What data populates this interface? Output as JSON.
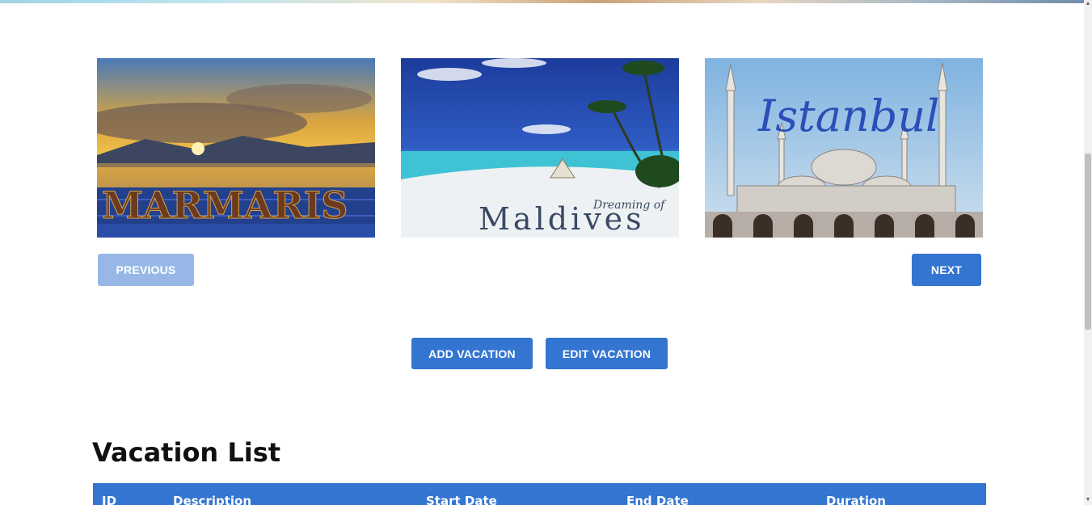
{
  "carousel": {
    "images": [
      {
        "alt": "Marmaris",
        "caption": "MARMARIS"
      },
      {
        "alt": "Maldives",
        "caption": "Maldives",
        "subcaption": "Dreaming of"
      },
      {
        "alt": "Istanbul",
        "caption": "Istanbul"
      }
    ],
    "previous_label": "PREVIOUS",
    "next_label": "NEXT"
  },
  "actions": {
    "add_label": "ADD VACATION",
    "edit_label": "EDIT VACATION"
  },
  "vacation_list": {
    "title": "Vacation List",
    "columns": [
      "ID",
      "Description",
      "Start Date",
      "End Date",
      "Duration"
    ]
  },
  "colors": {
    "primary": "#3375d0",
    "primary_disabled": "#97b8e6"
  }
}
